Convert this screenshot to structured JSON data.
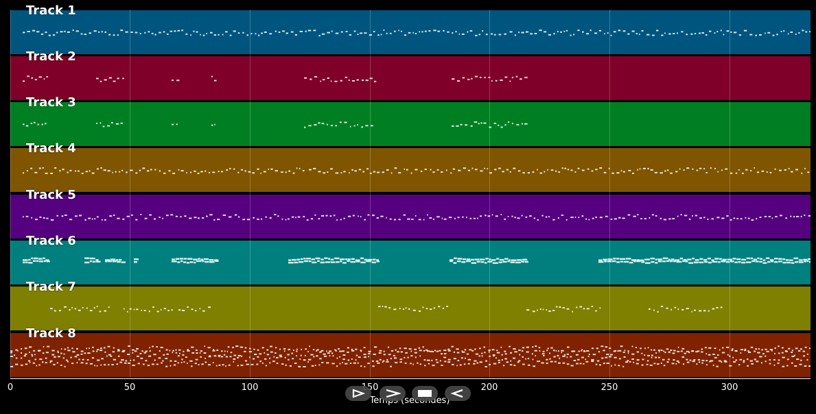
{
  "tracks": [
    {
      "name": "Track 1",
      "color": "#00557f"
    },
    {
      "name": "Track 2",
      "color": "#7f0028"
    },
    {
      "name": "Track 3",
      "color": "#007f22"
    },
    {
      "name": "Track 4",
      "color": "#7f5500"
    },
    {
      "name": "Track 5",
      "color": "#55007f"
    },
    {
      "name": "Track 6",
      "color": "#007f7f"
    },
    {
      "name": "Track 7",
      "color": "#7f7f00"
    },
    {
      "name": "Track 8",
      "color": "#7f2200"
    }
  ],
  "axis": {
    "ticks": [
      "0",
      "50",
      "100",
      "150",
      "200",
      "250",
      "300"
    ],
    "xlabel": "Temps (secondes)"
  },
  "controls": {
    "play_icon": "play-outline-icon",
    "forward_icon": "chevron-right-icon",
    "stop_icon": "stop-icon",
    "back_icon": "back-icon"
  }
}
